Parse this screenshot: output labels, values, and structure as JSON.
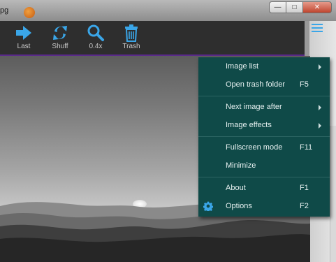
{
  "window": {
    "title_fragment": "pg",
    "minimize_glyph": "—",
    "maximize_glyph": "□",
    "close_glyph": "✕"
  },
  "toolbar": {
    "items": [
      {
        "label": "Last",
        "icon": "arrow-right-icon"
      },
      {
        "label": "Shuff",
        "icon": "shuffle-icon"
      },
      {
        "label": "0.4x",
        "icon": "zoom-icon"
      },
      {
        "label": "Trash",
        "icon": "trash-icon"
      }
    ],
    "menu_icon": "hamburger-icon"
  },
  "menu": {
    "items": [
      {
        "label": "Image list",
        "shortcut": "",
        "submenu": true
      },
      {
        "label": "Open trash folder",
        "shortcut": "F5",
        "submenu": false
      },
      {
        "label": "Next image after",
        "shortcut": "",
        "submenu": true
      },
      {
        "label": "Image effects",
        "shortcut": "",
        "submenu": true
      },
      {
        "label": "Fullscreen mode",
        "shortcut": "F11",
        "submenu": false
      },
      {
        "label": "Minimize",
        "shortcut": "",
        "submenu": false
      },
      {
        "label": "About",
        "shortcut": "F1",
        "submenu": false
      },
      {
        "label": "Options",
        "shortcut": "F2",
        "submenu": false,
        "icon": "gear-icon"
      }
    ]
  },
  "colors": {
    "accent": "#3aa6e8",
    "menu_bg": "#0f4a48",
    "toolbar_bg": "#2e2e2e"
  }
}
